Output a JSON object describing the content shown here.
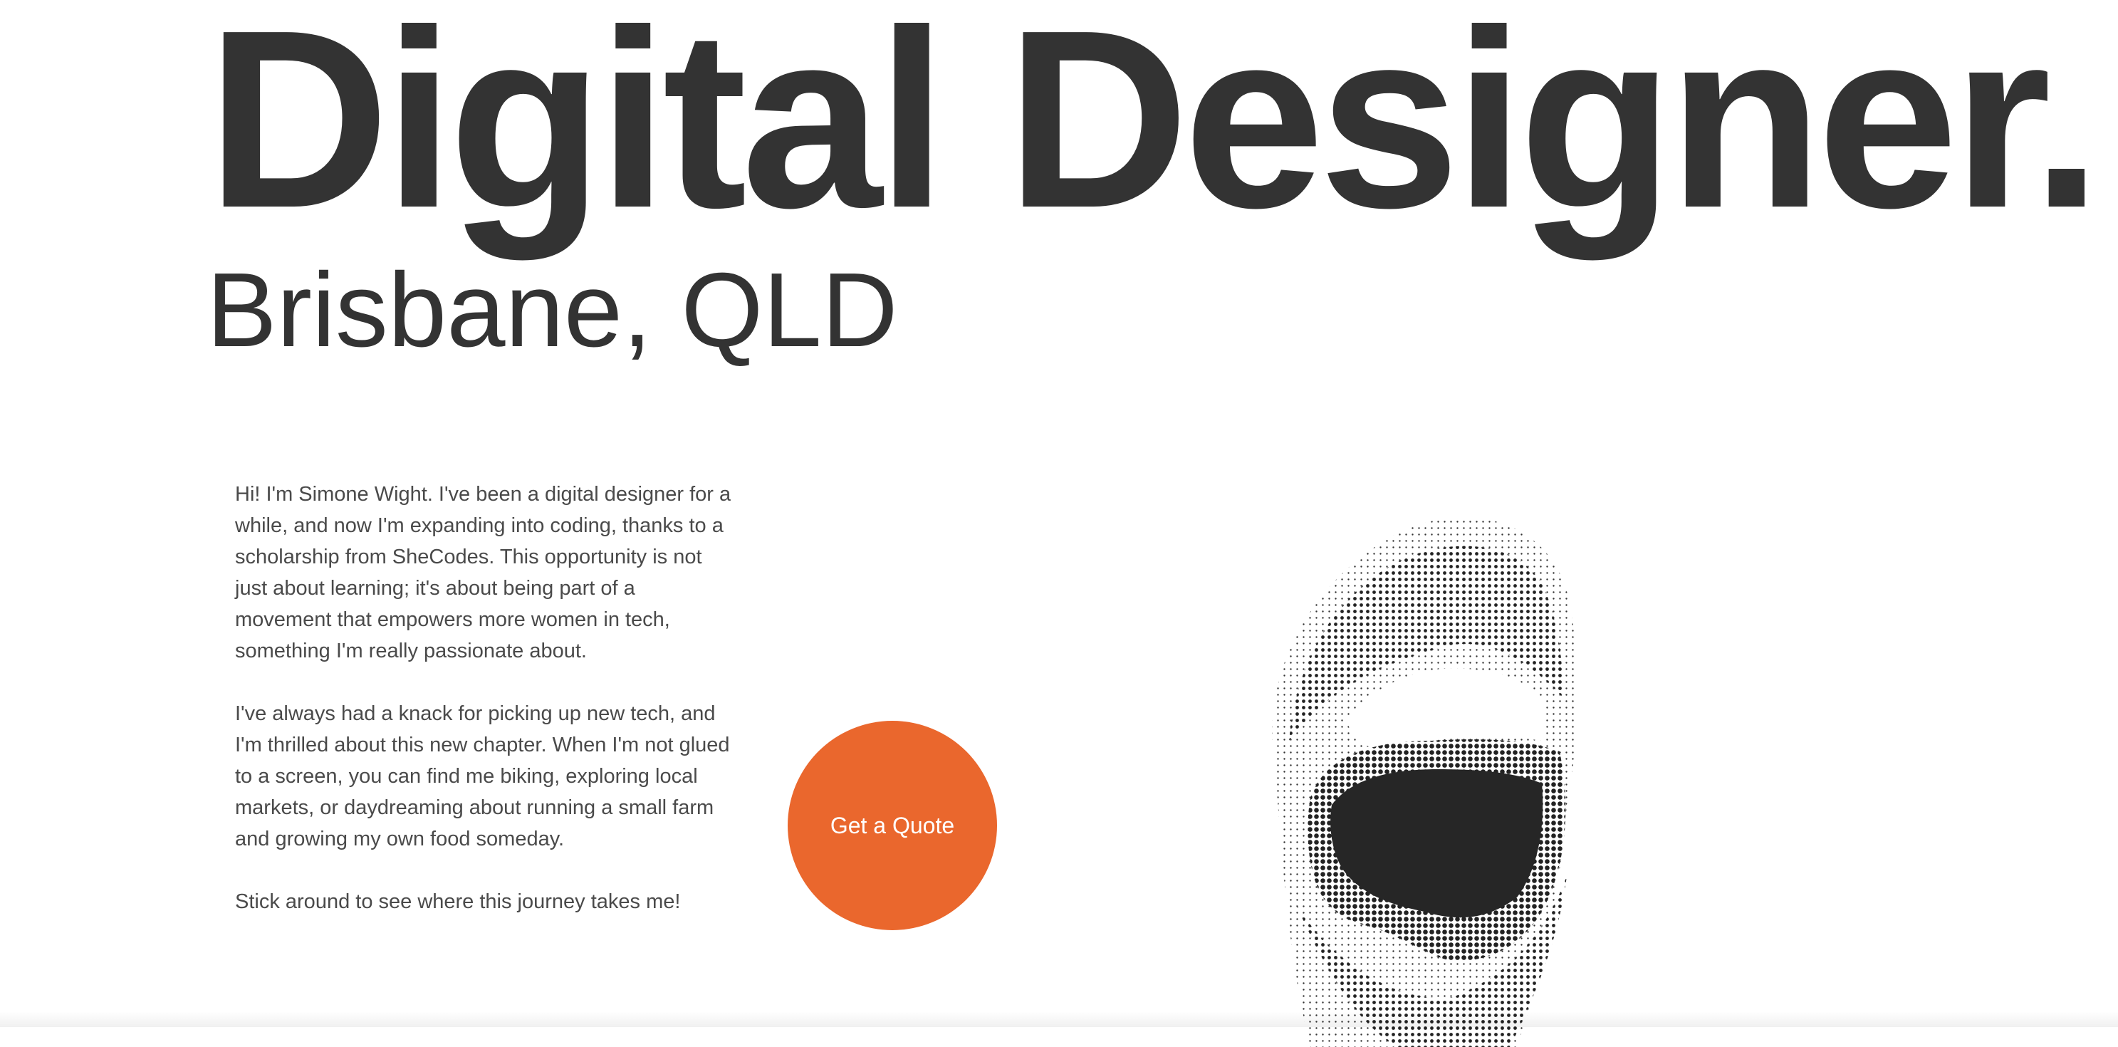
{
  "hero": {
    "title": "Digital Designer.",
    "subtitle": "Brisbane, QLD"
  },
  "bio": {
    "paragraphs": [
      "Hi! I'm Simone Wight. I've been a digital designer for a while, and now I'm expanding into coding, thanks to a scholarship from SheCodes. This opportunity is not just about learning; it's about being part of a movement that empowers more women in tech, something I'm really passionate about.",
      "I've always had a knack for picking up new tech, and I'm thrilled about this new chapter. When I'm not glued to a screen, you can find me biking, exploring local markets, or daydreaming about running a small farm and growing my own food someday.",
      "Stick around to see where this journey takes me!"
    ]
  },
  "cta": {
    "label": "Get a Quote",
    "color": "#ea672d"
  },
  "image": {
    "icon": "halftone-mouth-image"
  },
  "colors": {
    "text": "#333333",
    "body_text": "#4a4a4a",
    "background": "#ffffff"
  }
}
